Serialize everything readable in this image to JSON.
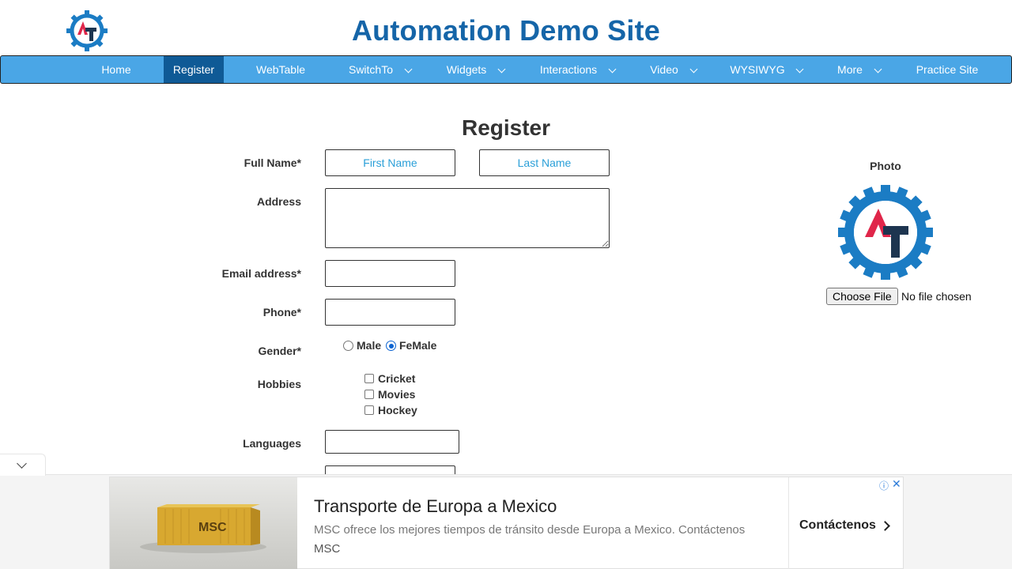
{
  "header": {
    "title": "Automation Demo Site",
    "logo_icon": "gear-at-logo-icon"
  },
  "nav": {
    "items": [
      {
        "label": "Home",
        "dropdown": false,
        "active": false
      },
      {
        "label": "Register",
        "dropdown": false,
        "active": true
      },
      {
        "label": "WebTable",
        "dropdown": false,
        "active": false
      },
      {
        "label": "SwitchTo",
        "dropdown": true,
        "active": false
      },
      {
        "label": "Widgets",
        "dropdown": true,
        "active": false
      },
      {
        "label": "Interactions",
        "dropdown": true,
        "active": false
      },
      {
        "label": "Video",
        "dropdown": true,
        "active": false
      },
      {
        "label": "WYSIWYG",
        "dropdown": true,
        "active": false
      },
      {
        "label": "More",
        "dropdown": true,
        "active": false
      },
      {
        "label": "Practice Site",
        "dropdown": false,
        "active": false
      }
    ],
    "bg_color": "#4aa6e6",
    "active_color": "#0f5a96"
  },
  "form": {
    "heading": "Register",
    "full_name_label": "Full Name*",
    "first_name_placeholder": "First Name",
    "last_name_placeholder": "Last Name",
    "address_label": "Address",
    "email_label": "Email address*",
    "phone_label": "Phone*",
    "gender_label": "Gender*",
    "gender_options": [
      {
        "label": "Male",
        "checked": false
      },
      {
        "label": "FeMale",
        "checked": true
      }
    ],
    "hobbies_label": "Hobbies",
    "hobbies": [
      {
        "label": "Cricket",
        "checked": false
      },
      {
        "label": "Movies",
        "checked": false
      },
      {
        "label": "Hockey",
        "checked": false
      }
    ],
    "languages_label": "Languages"
  },
  "photo": {
    "label": "Photo",
    "choose_file_label": "Choose File",
    "file_status": "No file chosen"
  },
  "ad": {
    "headline": "Transporte de Europa a Mexico",
    "description": "MSC ofrece los mejores tiempos de tránsito desde Europa a Mexico. Contáctenos",
    "source": "MSC",
    "cta": "Contáctenos",
    "info_icon": "ⓘ",
    "close_icon": "✕",
    "image_text": "MSC"
  }
}
